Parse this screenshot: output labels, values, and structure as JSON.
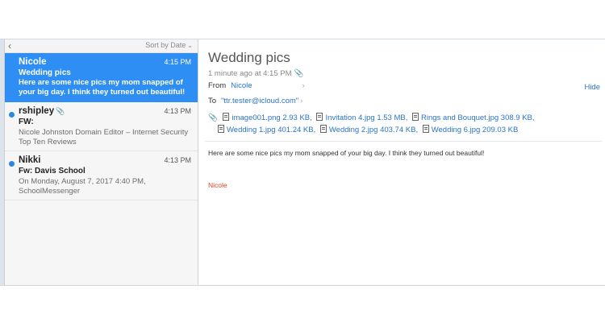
{
  "list_pane": {
    "back_label": "‹",
    "sort_label": "Sort by Date",
    "sort_caret": "⌄",
    "messages": [
      {
        "sender": "Nicole",
        "time": "4:15 PM",
        "subject": "Wedding pics",
        "preview": "Here are some nice pics my mom snapped of your big day. I think they turned out beautiful!",
        "selected": true
      },
      {
        "sender": "rshipley",
        "attachment_icon": "paperclip-icon",
        "time": "4:13 PM",
        "subject": "FW:",
        "preview": "Nicole Johnston Domain Editor – Internet Security Top Ten Reviews",
        "unread": true
      },
      {
        "sender": "Nikki",
        "time": "4:13 PM",
        "subject": "Fw: Davis School",
        "preview": "On Monday, August 7, 2017 4:40 PM, SchoolMessenger",
        "unread": true
      }
    ]
  },
  "reading_pane": {
    "subject": "Wedding pics",
    "date_line": "1 minute ago at 4:15 PM",
    "from_label": "From",
    "from_name": "Nicole",
    "hide_label": "Hide",
    "to_label": "To",
    "to_address": "\"ttr.tester@icloud.com\"",
    "chevron": "›",
    "attachments_row1": [
      {
        "name": "image001.png",
        "size": "2.93 KB"
      },
      {
        "name": "Invitation 4.jpg",
        "size": "1.53 MB"
      },
      {
        "name": "Rings and Bouquet.jpg",
        "size": "308.9 KB"
      }
    ],
    "attachments_row2": [
      {
        "name": "Wedding 1.jpg",
        "size": "401.24 KB"
      },
      {
        "name": "Wedding 2.jpg",
        "size": "403.74 KB"
      },
      {
        "name": "Wedding 6.jpg",
        "size": "209.03 KB"
      }
    ],
    "body": "Here are some nice pics my mom snapped of your big day. I think they turned out beautiful!",
    "signature": "Nicole"
  },
  "colors": {
    "selection": "#2e8ef3",
    "link": "#2a73c9",
    "unread_dot": "#2d86e6",
    "signature": "#d0442b"
  }
}
